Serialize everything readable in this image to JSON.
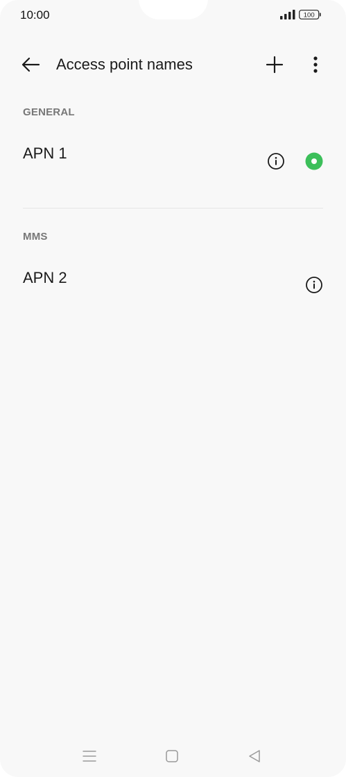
{
  "status_bar": {
    "time": "10:00",
    "battery_level": "100",
    "signal_icon": "signal-bars-icon",
    "battery_icon": "battery-icon"
  },
  "toolbar": {
    "title": "Access point names",
    "back_icon": "arrow-left-icon",
    "add_icon": "plus-icon",
    "more_icon": "more-vertical-icon"
  },
  "sections": [
    {
      "header": "GENERAL",
      "items": [
        {
          "name": "APN 1",
          "selected": true
        }
      ]
    },
    {
      "header": "MMS",
      "items": [
        {
          "name": "APN 2",
          "selected": false
        }
      ]
    }
  ],
  "colors": {
    "accent": "#3cbf5a",
    "background": "#f8f8f8",
    "section_header": "#777777",
    "divider": "#e6e6e6"
  },
  "nav_bar": {
    "menu_icon": "menu-icon",
    "home_icon": "home-square-icon",
    "back_icon": "back-triangle-icon"
  }
}
